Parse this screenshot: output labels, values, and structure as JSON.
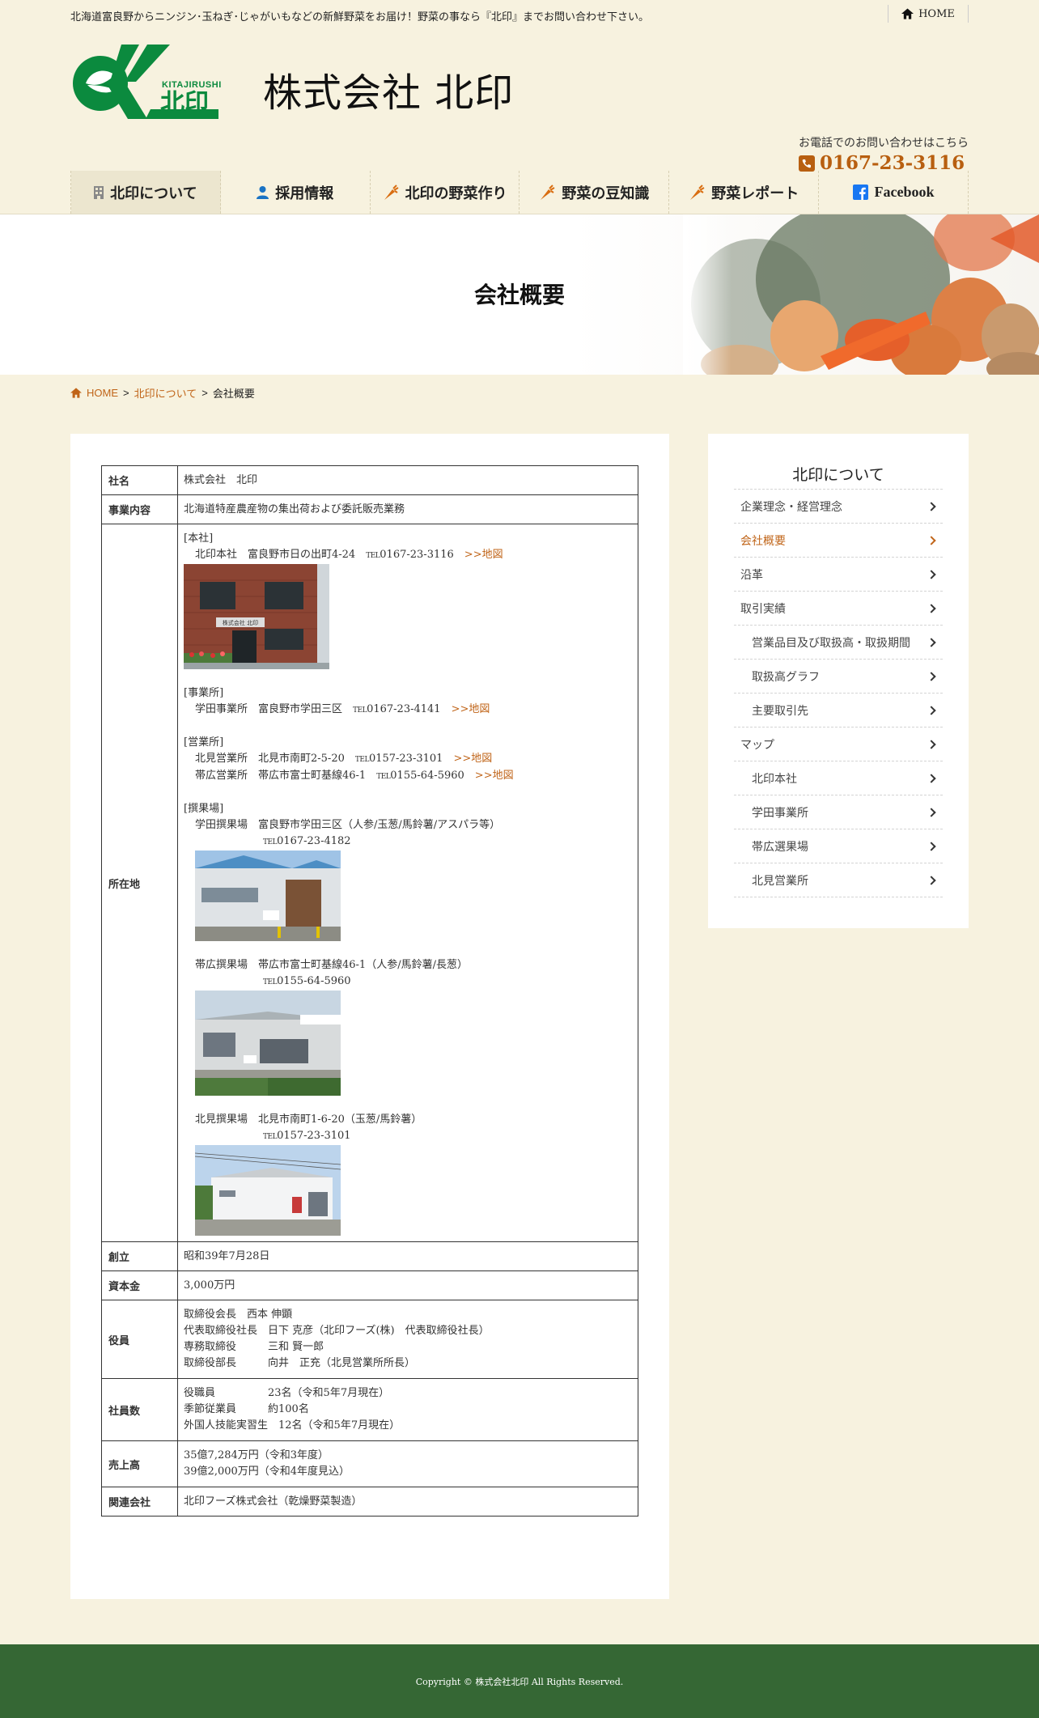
{
  "topbar": {
    "tagline": "北海道富良野からニンジン･玉ねぎ･じゃがいもなどの新鮮野菜をお届け！野菜の事なら『北印』までお問い合わせ下さい。",
    "home_label": "HOME"
  },
  "header": {
    "logo_text_en": "KITAJIRUSHI",
    "logo_text_ja": "北印",
    "company_name": "株式会社 北印",
    "contact_label": "お電話でのお問い合わせはこちら",
    "phone": "0167-23-3116"
  },
  "nav": {
    "items": [
      {
        "label": "北印について",
        "icon": "building-icon"
      },
      {
        "label": "採用情報",
        "icon": "person-icon"
      },
      {
        "label": "北印の野菜作り",
        "icon": "carrot-icon"
      },
      {
        "label": "野菜の豆知識",
        "icon": "carrot-icon"
      },
      {
        "label": "野菜レポート",
        "icon": "carrot-icon"
      },
      {
        "label": "Facebook",
        "icon": "facebook-icon"
      }
    ]
  },
  "hero": {
    "title": "会社概要"
  },
  "breadcrumb": {
    "home": "HOME",
    "parent": "北印について",
    "current": "会社概要",
    "sep": ">"
  },
  "table": {
    "name_h": "社名",
    "name_v": "株式会社　北印",
    "business_h": "事業内容",
    "business_v": "北海道特産農産物の集出荷および委託販売業務",
    "location_h": "所在地",
    "loc": {
      "honsha_head": "[本社]",
      "honsha_line": "北印本社　富良野市日の出町4-24　",
      "tel_mark": "TEL",
      "honsha_tel": "0167-23-3116",
      "map_link": ">>地図",
      "jigyosho_head": "[事業所]",
      "gakuden_line": "学田事業所　富良野市学田三区　",
      "gakuden_tel": "0167-23-4141",
      "eigyosho_head": "[営業所]",
      "kitami_line": "北見営業所　北見市南町2-5-20　",
      "kitami_tel": "0157-23-3101",
      "obihiro_line": "帯広営業所　帯広市富士町基線46-1　",
      "obihiro_tel": "0155-64-5960",
      "senka_head": "[撰果場]",
      "s_gakuden_line": "学田撰果場　富良野市学田三区（人参/玉葱/馬鈴薯/アスパラ等）",
      "s_gakuden_tel": "0167-23-4182",
      "s_obihiro_line": "帯広撰果場　帯広市富士町基線46-1（人参/馬鈴薯/長葱）",
      "s_obihiro_tel": "0155-64-5960",
      "s_kitami_line": "北見撰果場　北見市南町1-6-20（玉葱/馬鈴薯）",
      "s_kitami_tel": "0157-23-3101",
      "sign_text": "株式会社 北印"
    },
    "founded_h": "創立",
    "founded_v": "昭和39年7月28日",
    "capital_h": "資本金",
    "capital_v": "3,000万円",
    "officers_h": "役員",
    "officers": [
      "取締役会長　西本 伸顕",
      "代表取締役社長　日下 克彦（北印フーズ(株)　代表取締役社長）",
      "専務取締役　　　三和 賢一郎",
      "取締役部長　　　向井　正充（北見営業所所長）"
    ],
    "staff_h": "社員数",
    "staff": [
      "役職員　　　　　23名（令和5年7月現在）",
      "季節従業員　　　約100名",
      "外国人技能実習生　12名（令和5年7月現在）"
    ],
    "sales_h": "売上高",
    "sales": [
      "35億7,284万円（令和3年度）",
      "39億2,000万円（令和4年度見込）"
    ],
    "related_h": "関連会社",
    "related_v": "北印フーズ株式会社（乾燥野菜製造）"
  },
  "sidebar": {
    "title": "北印について",
    "items": [
      "企業理念・経営理念",
      "会社概要",
      "沿革",
      "取引実績",
      "営業品目及び取扱高・取扱期間",
      "取扱高グラフ",
      "主要取引先",
      "マップ",
      "北印本社",
      "学田事業所",
      "帯広選果場",
      "北見営業所"
    ]
  },
  "footer": {
    "copyright": "Copyright © 株式会社北印 All Rights Reserved."
  },
  "colors": {
    "accent": "#c06418",
    "footer": "#356734",
    "logo_green": "#0b8a3e",
    "background": "#f7f2df"
  }
}
